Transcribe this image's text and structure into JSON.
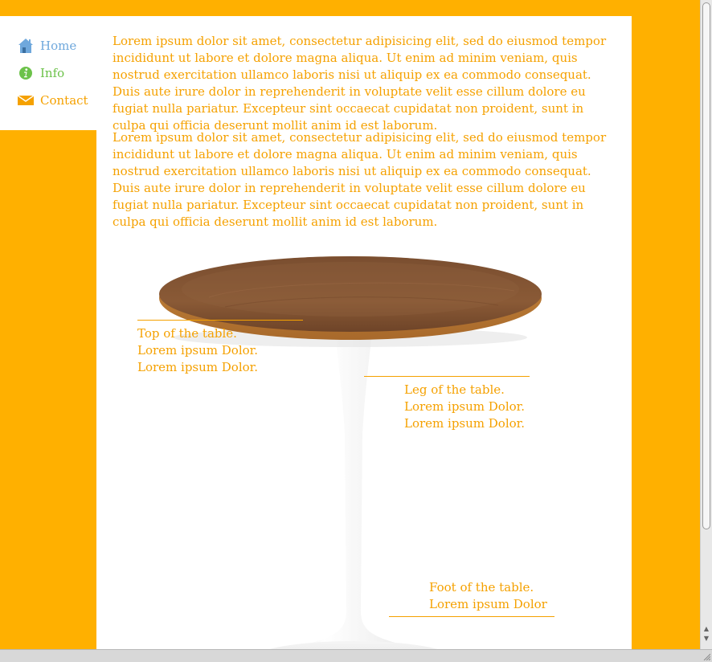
{
  "nav": {
    "items": [
      {
        "label": "Home",
        "icon": "home-icon",
        "color": "#6FA8DC"
      },
      {
        "label": "Info",
        "icon": "info-icon",
        "color": "#6CC24A"
      },
      {
        "label": "Contact",
        "icon": "mail-icon",
        "color": "#F5A100"
      }
    ]
  },
  "content": {
    "paragraphs": [
      "Lorem ipsum dolor sit amet, consectetur adipisicing elit, sed do eiusmod tempor incididunt ut labore et dolore magna aliqua. Ut enim ad minim veniam, quis nostrud exercitation ullamco laboris nisi ut aliquip ex ea commodo consequat. Duis aute irure dolor in reprehenderit in voluptate velit esse cillum dolore eu fugiat nulla pariatur. Excepteur sint occaecat cupidatat non proident, sunt in culpa qui officia deserunt mollit anim id est laborum.",
      "Lorem ipsum dolor sit amet, consectetur adipisicing elit, sed do eiusmod tempor incididunt ut labore et dolore magna aliqua. Ut enim ad minim veniam, quis nostrud exercitation ullamco laboris nisi ut aliquip ex ea commodo consequat. Duis aute irure dolor in reprehenderit in voluptate velit esse cillum dolore eu fugiat nulla pariatur. Excepteur sint occaecat cupidatat non proident, sunt in culpa qui officia deserunt mollit anim id est laborum."
    ]
  },
  "annotations": {
    "top": "Top of the table. Lorem ipsum Dolor. Lorem ipsum Dolor.",
    "leg": "Leg of the table. Lorem ipsum Dolor. Lorem ipsum Dolor.",
    "foot": "Foot of the table. Lorem ipsum Dolor"
  },
  "colors": {
    "page_background": "#FFB000",
    "text_accent": "#F5A100",
    "panel_background": "#FFFFFF"
  }
}
